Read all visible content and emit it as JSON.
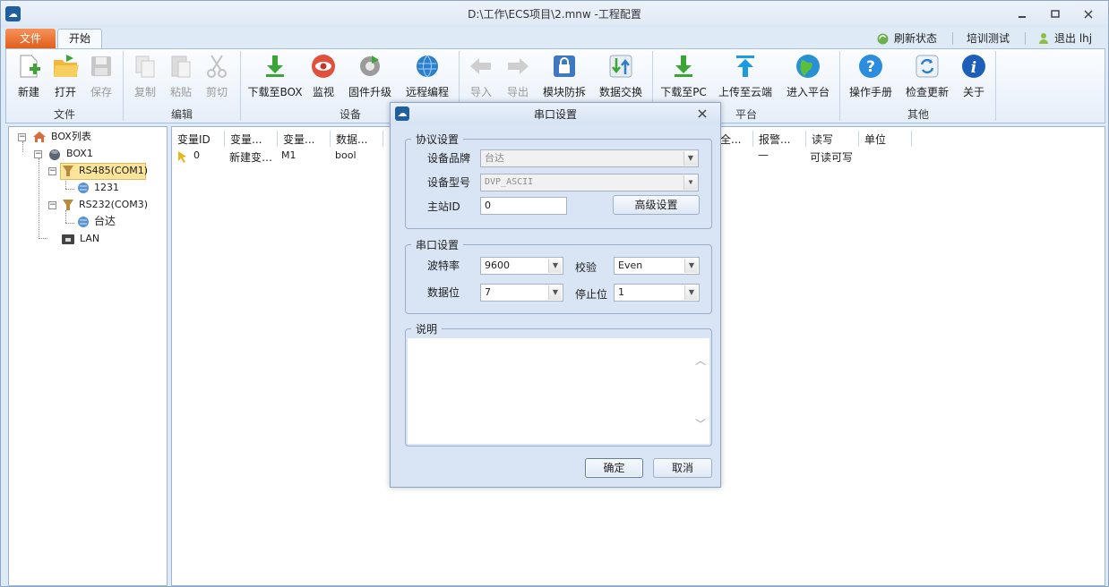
{
  "window": {
    "title": "D:\\工作\\ECS项目\\2.mnw -工程配置",
    "app_icon": "cloud-logo-icon",
    "min": "▢",
    "max": "▢",
    "close": "✕"
  },
  "tabs": {
    "file": "文件",
    "start": "开始"
  },
  "right_links": {
    "refresh": "刷新状态",
    "training": "培训测试",
    "logout": "退出 lhj"
  },
  "ribbon": {
    "groups": {
      "file": "文件",
      "edit": "编辑",
      "device": "设备",
      "platform": "平台",
      "other": "其他"
    },
    "buttons": {
      "new": "新建",
      "open": "打开",
      "save": "保存",
      "copy": "复制",
      "paste": "粘贴",
      "cut": "剪切",
      "download_box": "下载至BOX",
      "monitor": "监视",
      "firmware": "固件升级",
      "remote": "远程编程",
      "import": "导入",
      "export": "导出",
      "module_protect": "模块防拆",
      "data_exchange": "数据交换",
      "download_pc": "下载至PC",
      "upload_cloud": "上传至云端",
      "enter_platform": "进入平台",
      "manual": "操作手册",
      "check_update": "检查更新",
      "about": "关于"
    }
  },
  "tree": {
    "root": "BOX列表",
    "box": "BOX1",
    "rs485": "RS485(COM1)",
    "rs485_child": "1231",
    "rs232": "RS232(COM3)",
    "rs232_child": "台达",
    "lan": "LAN"
  },
  "table": {
    "headers": [
      "变量ID",
      "变量...",
      "变量...",
      "数据...",
      "全...",
      "报警...",
      "读写",
      "单位"
    ],
    "row": {
      "id": "0",
      "name": "新建变…",
      "addr": "M1",
      "type": "bool",
      "alarm": "—",
      "rw": "可读可写"
    }
  },
  "dialog": {
    "title": "串口设置",
    "close": "✕",
    "protocol": {
      "legend": "协议设置",
      "brand_label": "设备品牌",
      "brand_value": "台达",
      "model_label": "设备型号",
      "model_value": "DVP_ASCII",
      "station_label": "主站ID",
      "station_value": "0",
      "advanced": "高级设置"
    },
    "serial": {
      "legend": "串口设置",
      "baud_label": "波特率",
      "baud_value": "9600",
      "parity_label": "校验",
      "parity_value": "Even",
      "databits_label": "数据位",
      "databits_value": "7",
      "stopbits_label": "停止位",
      "stopbits_value": "1"
    },
    "desc": {
      "legend": "说明",
      "value": ""
    },
    "ok": "确定",
    "cancel": "取消"
  },
  "colors": {
    "accent": "#e86a2a",
    "ribbon_bg": "#e6eef9",
    "window_bg": "#dfeaf7"
  }
}
